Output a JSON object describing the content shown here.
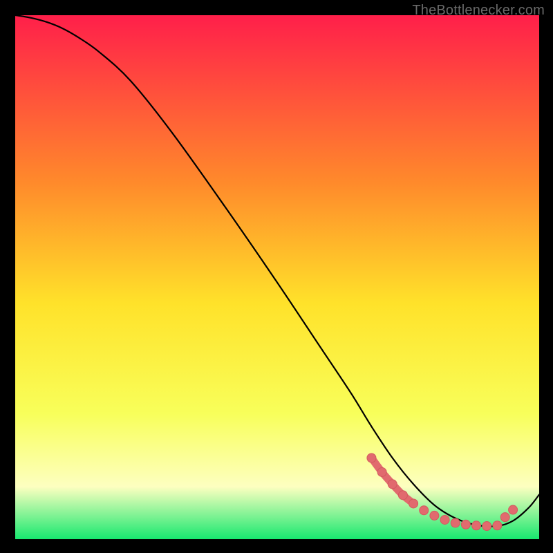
{
  "watermark": "TheBottlenecker.com",
  "colors": {
    "top": "#ff1f4a",
    "upper_mid": "#ff8a2b",
    "mid": "#ffe22a",
    "lower_mid": "#f8ff5a",
    "pale": "#fdffc0",
    "bottom": "#17e86f",
    "curve": "#000000",
    "dot_fill": "#e16a6e",
    "dot_stroke": "#d25a5e"
  },
  "chart_data": {
    "type": "line",
    "title": "",
    "xlabel": "",
    "ylabel": "",
    "xlim": [
      0,
      100
    ],
    "ylim": [
      0,
      100
    ],
    "curve": {
      "x": [
        0,
        3,
        6,
        9,
        12,
        16,
        22,
        30,
        40,
        50,
        58,
        64,
        68,
        72,
        76,
        80,
        84,
        88,
        92,
        95,
        98,
        100
      ],
      "y": [
        100,
        99.5,
        98.7,
        97.5,
        95.8,
        93,
        87.5,
        77.5,
        63.5,
        49,
        37,
        28,
        21.5,
        15.5,
        10.5,
        6.5,
        4,
        2.7,
        2.5,
        3.5,
        6,
        8.5
      ]
    },
    "dots": {
      "x": [
        68,
        70,
        72,
        74,
        76,
        78,
        80,
        82,
        84,
        86,
        88,
        90,
        92,
        93.5,
        95
      ],
      "y": [
        15.5,
        12.8,
        10.5,
        8.4,
        6.8,
        5.5,
        4.5,
        3.7,
        3.1,
        2.8,
        2.6,
        2.5,
        2.6,
        4.2,
        5.6
      ]
    },
    "thick_segment": {
      "x": [
        68,
        70,
        72,
        74,
        76
      ],
      "y": [
        15.5,
        12.8,
        10.5,
        8.4,
        6.8
      ]
    }
  }
}
